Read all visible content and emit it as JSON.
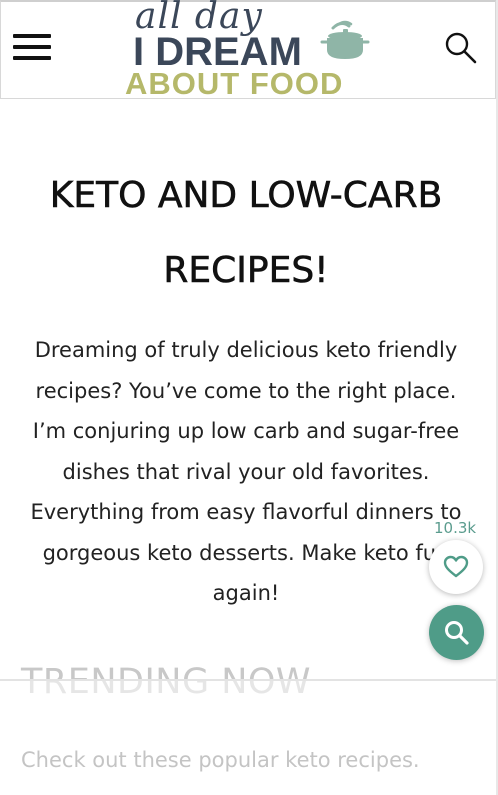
{
  "header": {
    "logo": {
      "script_text": "all day",
      "main_text": "I DREAM",
      "sub_text": "ABOUT FOOD"
    },
    "menu_icon": "hamburger-menu-icon",
    "search_icon": "search-icon"
  },
  "main": {
    "heading": "KETO AND LOW-CARB RECIPES!",
    "intro": "Dreaming of truly delicious keto friendly recipes? You’ve come to the right place. I’m conjuring up low carb and sugar-free dishes that rival your old favorites. Everything from easy flavorful dinners to gorgeous keto desserts. Make keto fun again!"
  },
  "trending": {
    "title": "TRENDING NOW",
    "subtitle": "Check out these popular keto recipes."
  },
  "floating": {
    "favorites_count": "10.3k",
    "favorite_icon": "heart-icon",
    "search_fab_icon": "search-icon"
  },
  "colors": {
    "logo_dark": "#3b4759",
    "logo_accent": "#b5b86a",
    "teal": "#4f9c88",
    "text": "#111111"
  }
}
